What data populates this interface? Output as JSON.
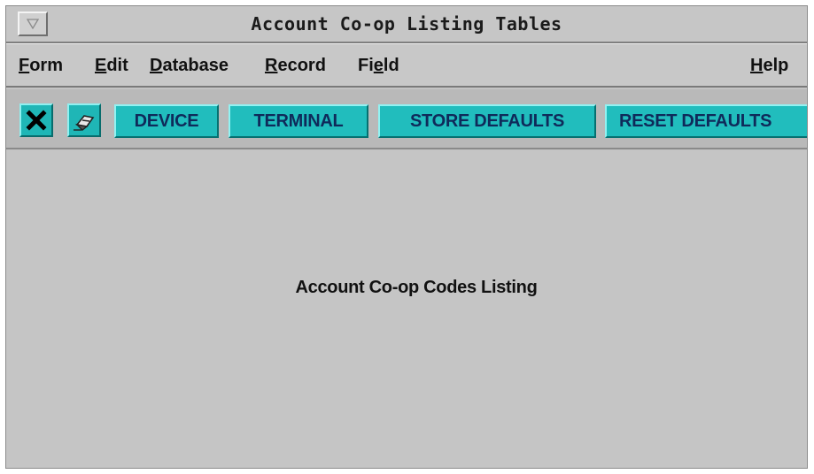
{
  "window": {
    "title": "Account Co-op Listing Tables"
  },
  "menubar": {
    "form": {
      "mnemonic": "F",
      "rest": "orm"
    },
    "edit": {
      "mnemonic": "E",
      "rest": "dit"
    },
    "database": {
      "mnemonic": "D",
      "rest": "atabase"
    },
    "record": {
      "mnemonic": "R",
      "rest": "ecord"
    },
    "field": {
      "pre": "Fi",
      "mnemonic": "e",
      "rest": "ld"
    },
    "help": {
      "mnemonic": "H",
      "rest": "elp"
    }
  },
  "toolbar": {
    "icons": [
      "close-x-icon",
      "eraser-icon"
    ],
    "device_label": "DEVICE",
    "terminal_label": "TERMINAL",
    "store_defaults_label": "STORE DEFAULTS",
    "reset_defaults_label": "RESET DEFAULTS"
  },
  "content": {
    "label": "Account Co-op Codes Listing"
  },
  "colors": {
    "window_bg": "#c4c4c4",
    "button_teal": "#21bdbd",
    "button_text": "#0f2a5a"
  }
}
